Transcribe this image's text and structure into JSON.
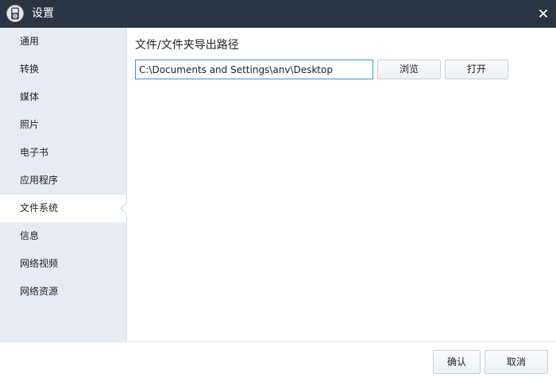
{
  "window": {
    "title": "设置",
    "close_icon": "close-icon",
    "app_icon": "ipod-icon"
  },
  "sidebar": {
    "items": [
      {
        "label": "通用"
      },
      {
        "label": "转换"
      },
      {
        "label": "媒体"
      },
      {
        "label": "照片"
      },
      {
        "label": "电子书"
      },
      {
        "label": "应用程序"
      },
      {
        "label": "文件系统",
        "active": true
      },
      {
        "label": "信息"
      },
      {
        "label": "网络视频"
      },
      {
        "label": "网络资源"
      }
    ]
  },
  "main": {
    "section_label": "文件/文件夹导出路径",
    "path_value": "C:\\Documents and Settings\\anv\\Desktop",
    "browse_label": "浏览",
    "open_label": "打开"
  },
  "footer": {
    "ok_label": "确认",
    "cancel_label": "取消"
  },
  "colors": {
    "titlebar": "#2a3543",
    "sidebar": "#e5ecf3",
    "input_border": "#3c93d8"
  }
}
